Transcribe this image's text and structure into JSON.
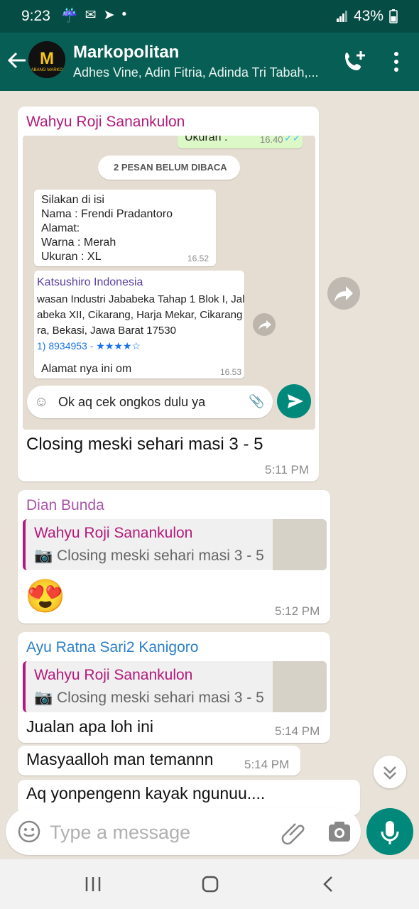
{
  "status_bar": {
    "time": "9:23",
    "battery": "43%"
  },
  "header": {
    "title": "Markopolitan",
    "subtitle": "Adhes Vine, Adin Fitria, Adinda Tri Tabah,...",
    "avatar_text_top": "M",
    "avatar_text_bottom": "ABANG MARKO"
  },
  "screenshot_message": {
    "sender": "Wahyu Roji Sanankulon",
    "caption": "Closing meski sehari masi 3 - 5",
    "time": "5:11 PM",
    "embedded": {
      "top_text": "Ukuran :",
      "top_time": "16.40",
      "unread_label": "2 PESAN BELUM DIBACA",
      "form_lines": [
        "Silakan di isi",
        "Nama : Frendi Pradantoro",
        "Alamat:",
        "Warna : Merah",
        "Ukuran : XL"
      ],
      "form_time": "16.52",
      "map_title": "Katsushiro Indonesia",
      "map_lines": [
        "wasan Industri Jababeka Tahap 1 Blok I, Jala",
        "abeka XII, Cikarang, Harja Mekar, Cikarang",
        "ra, Bekasi, Jawa Barat 17530",
        "1) 8934953 - ★★★★☆"
      ],
      "address_text": "Alamat nya ini om",
      "address_time": "16.53",
      "input_text": "Ok aq cek ongkos dulu ya"
    }
  },
  "messages": [
    {
      "sender": "Dian Bunda",
      "sender_color": "#a855a8",
      "quote_name": "Wahyu Roji Sanankulon",
      "quote_text": "Closing meski sehari masi 3 - 5",
      "emoji": "😍",
      "time": "5:12 PM"
    },
    {
      "sender": "Ayu Ratna Sari2 Kanigoro",
      "sender_color": "#2a7fc9",
      "quote_name": "Wahyu Roji Sanankulon",
      "quote_text": "Closing meski sehari masi 3 - 5",
      "text": "Jualan apa loh ini",
      "time": "5:14 PM"
    },
    {
      "text": "Masyaalloh man temannn",
      "time": "5:14 PM"
    },
    {
      "text": "Aq yonpengenn kayak ngunuu...."
    }
  ],
  "input": {
    "placeholder": "Type a message"
  },
  "colors": {
    "header": "#075e54",
    "accent": "#00897b",
    "sender1": "#b3197a"
  }
}
